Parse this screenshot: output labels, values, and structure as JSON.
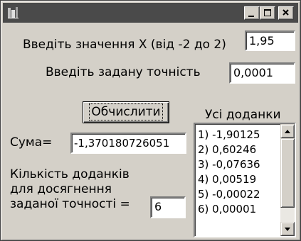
{
  "window": {
    "controls": {
      "minimize_icon": "minimize-icon",
      "maximize_icon": "maximize-icon",
      "close_icon": "close-icon"
    }
  },
  "form": {
    "x_label": "Введіть значення X (від -2 до 2)",
    "x_value": "1,95",
    "eps_label": "Введіть задану точність",
    "eps_value": "0,0001",
    "compute_label": "Обчислити",
    "sum_label": "Сума=",
    "sum_value": "-1,370180726051",
    "count_label_line1": "Кількість доданків",
    "count_label_line2": "для досягнення",
    "count_label_line3": "заданої точності =",
    "count_value": "6"
  },
  "terms": {
    "title": "Усі доданки",
    "items": [
      "1) -1,90125",
      "2) 0,60246",
      "3) -0,07636",
      "4) 0,00519",
      "5) -0,00022",
      "6) 0,00001"
    ]
  },
  "colors": {
    "titlebar": "#4a4a4a",
    "face": "#d4d0c8"
  }
}
